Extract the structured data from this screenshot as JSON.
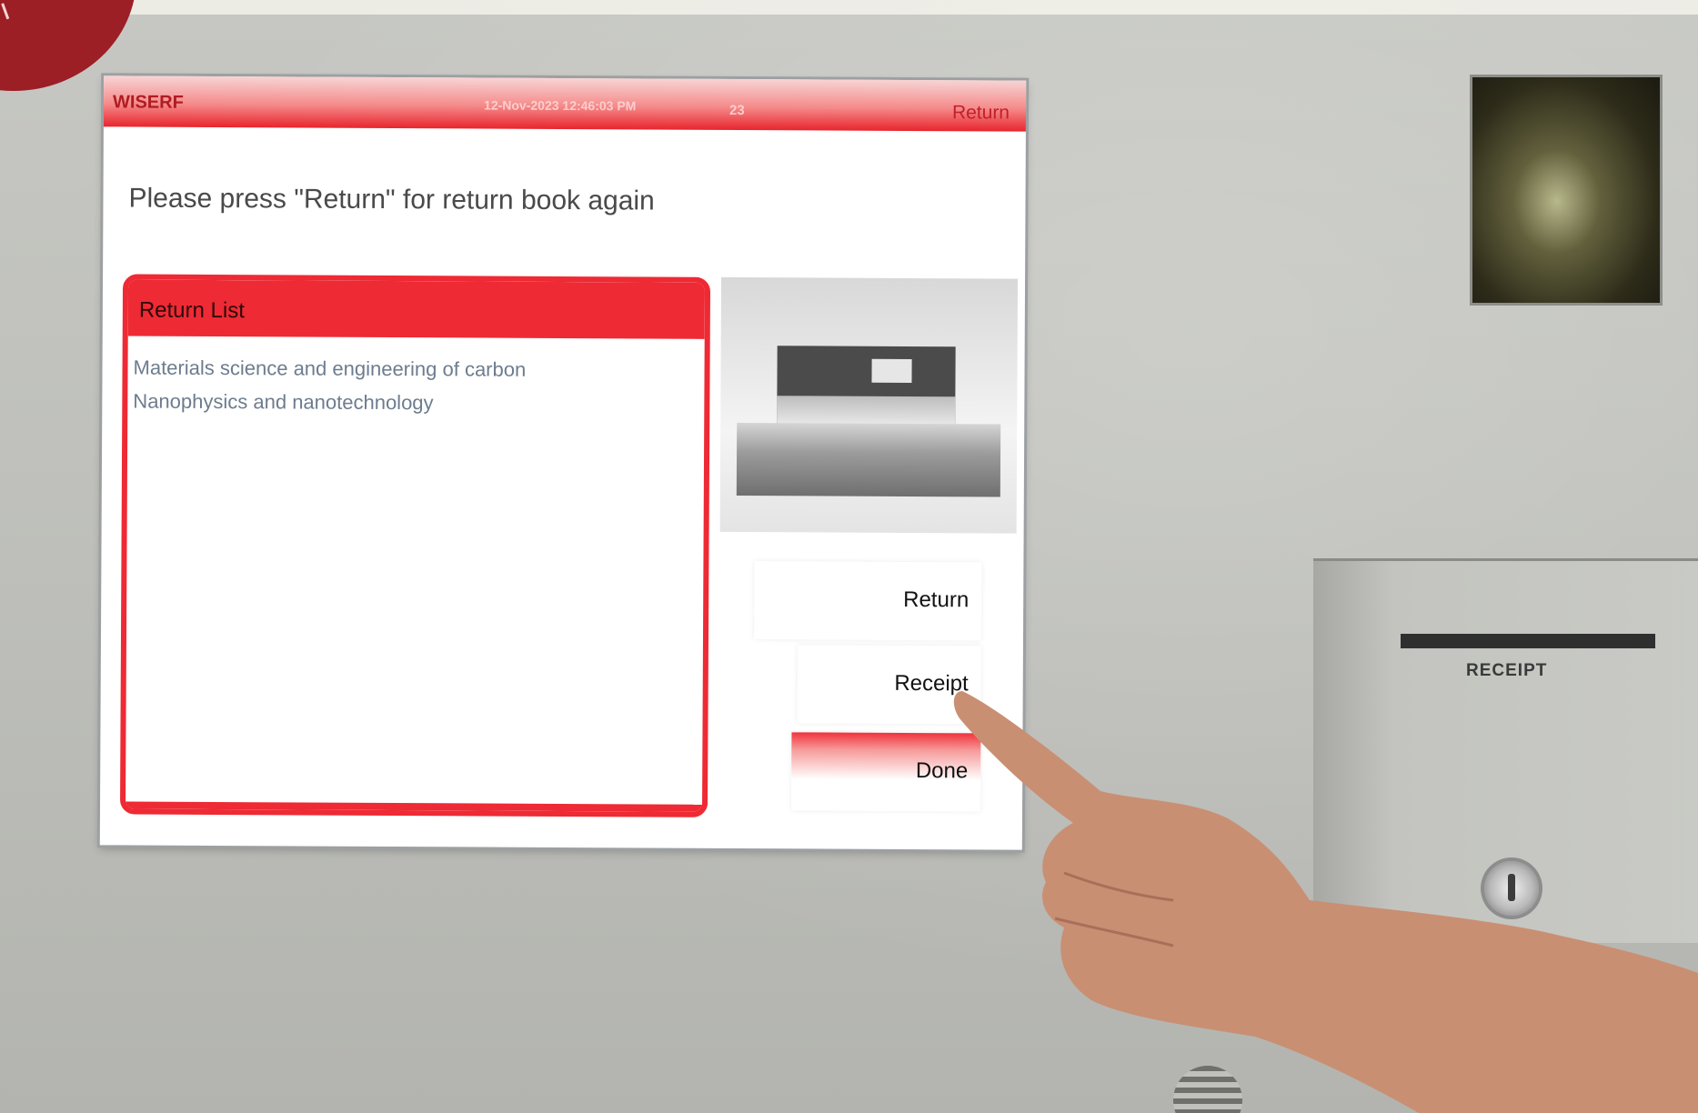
{
  "kiosk": {
    "brand": "WISERF",
    "datetime": "12-Nov-2023 12:46:03 PM",
    "counter": "23",
    "header_return_label": "Return",
    "instruction": "Please press \"Return\" for return book again",
    "return_list": {
      "title": "Return List",
      "items": [
        "Materials science and engineering of carbon",
        "Nanophysics and nanotechnology"
      ]
    },
    "buttons": {
      "return": "Return",
      "receipt": "Receipt",
      "done": "Done"
    }
  },
  "hardware": {
    "receipt_slot_label": "RECEIPT"
  },
  "colors": {
    "accent_red": "#ee2a34",
    "corner_badge": "#9c1f26",
    "wall": "#c6c7c2"
  }
}
